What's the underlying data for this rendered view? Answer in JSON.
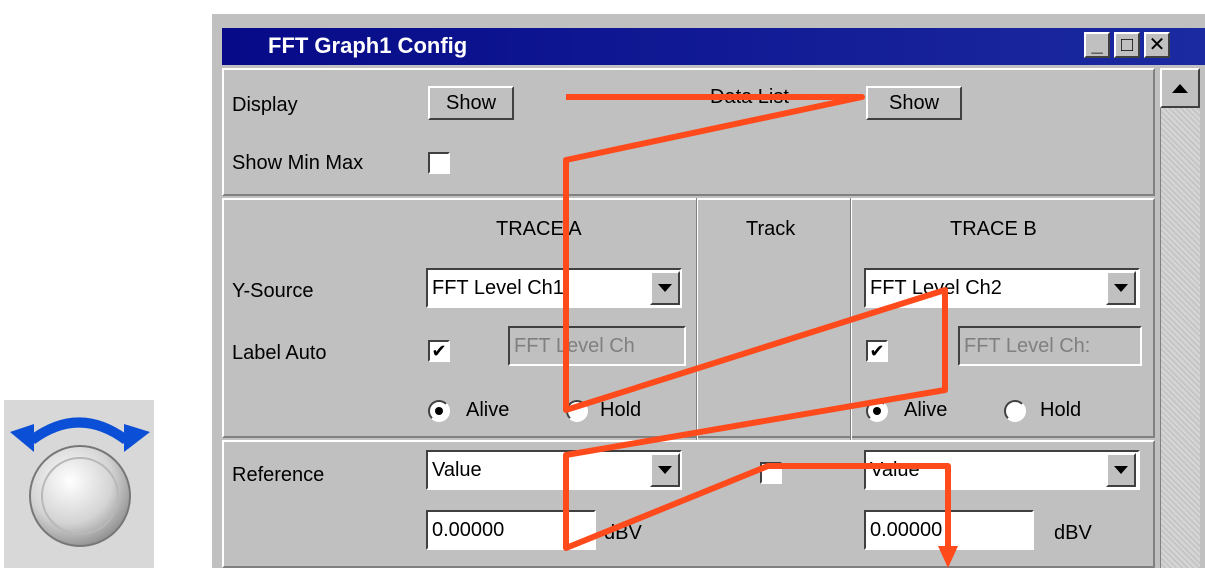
{
  "window": {
    "title": "FFT Graph1 Config",
    "min_glyph": "_",
    "max_glyph": "□",
    "close_glyph": "✕"
  },
  "display_section": {
    "display_label": "Display",
    "display_button": "Show",
    "data_list_label": "Data List",
    "data_list_button": "Show",
    "show_min_max_label": "Show Min Max",
    "show_min_max_checked": false
  },
  "trace_section": {
    "trace_a_header": "TRACE A",
    "track_header": "Track",
    "trace_b_header": "TRACE B",
    "y_source_label": "Y-Source",
    "trace_a_y_source": "FFT Level Ch1",
    "trace_b_y_source": "FFT Level Ch2",
    "label_auto_label": "Label Auto",
    "trace_a_label_auto_checked": true,
    "trace_b_label_auto_checked": true,
    "trace_a_label_text": "FFT Level Ch",
    "trace_b_label_text": "FFT Level Ch:",
    "alive_label": "Alive",
    "hold_label": "Hold",
    "trace_a_mode": "Alive",
    "trace_b_mode": "Alive"
  },
  "reference_section": {
    "reference_label": "Reference",
    "trace_a_reference": "Value",
    "trace_b_reference": "Value",
    "track_checked": false,
    "trace_a_value": "0.00000",
    "trace_b_value": "0.00000",
    "trace_a_unit": "dBV",
    "trace_b_unit": "dBV"
  },
  "check_glyph": "✔",
  "colors": {
    "titlebar": "#070a88",
    "panel": "#c0c0c0",
    "overlay_path": "#ff4a1c",
    "knob_arrow": "#0b4fd6"
  },
  "icons": {
    "knob": "rotary-knob-icon",
    "scroll_up": "scroll-up-arrow-icon"
  }
}
